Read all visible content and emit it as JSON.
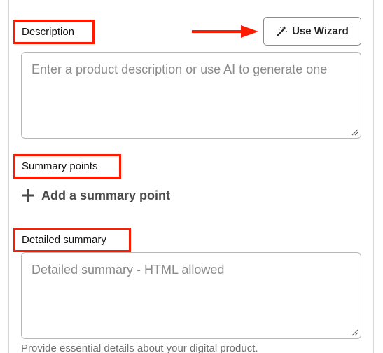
{
  "description": {
    "label": "Description",
    "wizard_button_label": "Use Wizard",
    "wizard_icon": "magic-wand-icon",
    "placeholder": "Enter a product description or use AI to generate one"
  },
  "summary_points": {
    "label": "Summary points",
    "add_label": "Add a summary point",
    "add_icon": "plus-icon"
  },
  "detailed_summary": {
    "label": "Detailed summary",
    "placeholder": "Detailed summary - HTML allowed",
    "help_text": "Provide essential details about your digital product."
  },
  "annotations": {
    "highlight_color": "#ff1a00",
    "arrow_icon": "arrow-right-icon"
  }
}
